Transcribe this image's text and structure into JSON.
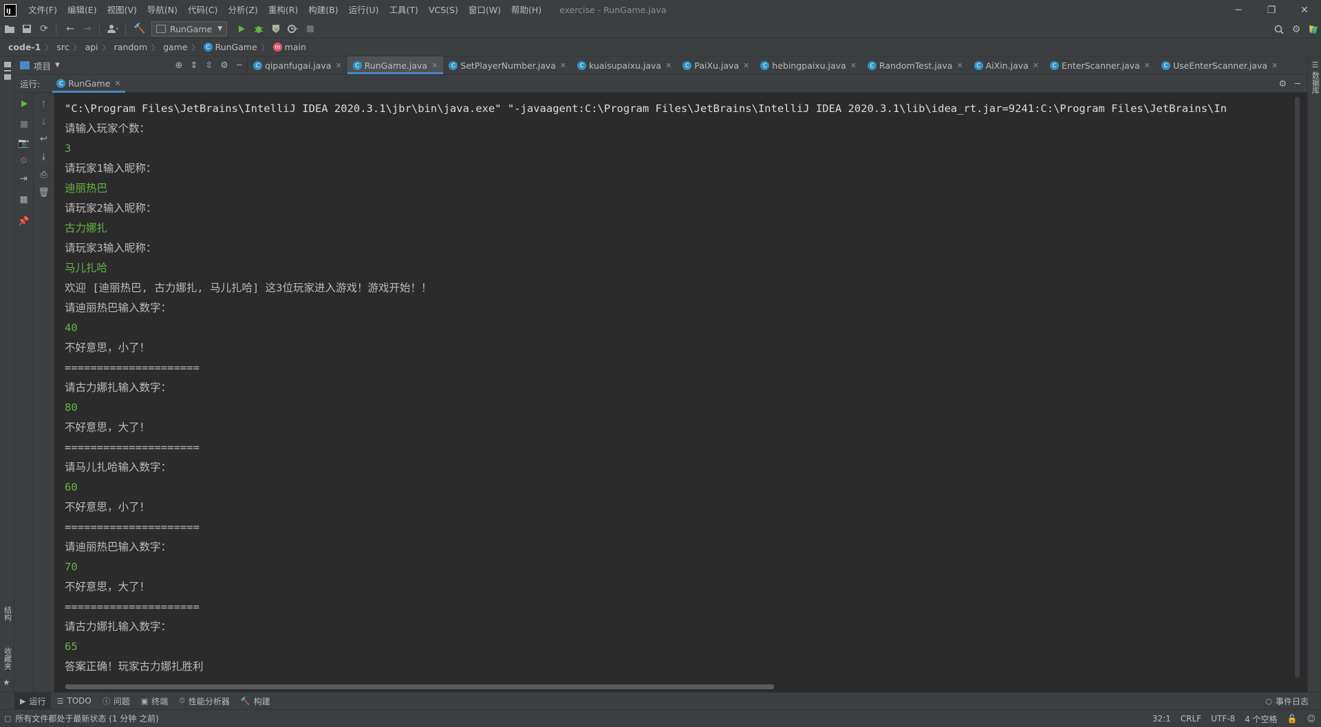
{
  "window": {
    "title": "exercise - RunGame.java",
    "minimize": "─",
    "restore": "❐",
    "close": "✕"
  },
  "menu": [
    "文件(F)",
    "编辑(E)",
    "视图(V)",
    "导航(N)",
    "代码(C)",
    "分析(Z)",
    "重构(R)",
    "构建(B)",
    "运行(U)",
    "工具(T)",
    "VCS(S)",
    "窗口(W)",
    "帮助(H)"
  ],
  "toolbar": {
    "run_config": "RunGame"
  },
  "breadcrumb": [
    "code-1",
    "src",
    "api",
    "random",
    "game",
    "RunGame",
    "main"
  ],
  "project_panel": {
    "label": "项目"
  },
  "editor_tabs": [
    {
      "label": "qipanfugai.java",
      "active": false
    },
    {
      "label": "RunGame.java",
      "active": true
    },
    {
      "label": "SetPlayerNumber.java",
      "active": false
    },
    {
      "label": "kuaisupaixu.java",
      "active": false
    },
    {
      "label": "PaiXu.java",
      "active": false
    },
    {
      "label": "hebingpaixu.java",
      "active": false
    },
    {
      "label": "RandomTest.java",
      "active": false
    },
    {
      "label": "AiXin.java",
      "active": false
    },
    {
      "label": "EnterScanner.java",
      "active": false
    },
    {
      "label": "UseEnterScanner.java",
      "active": false
    }
  ],
  "run_window": {
    "label": "运行:",
    "tab": "RunGame"
  },
  "console": {
    "lines": [
      {
        "text": "\"C:\\Program Files\\JetBrains\\IntelliJ IDEA 2020.3.1\\jbr\\bin\\java.exe\" \"-javaagent:C:\\Program Files\\JetBrains\\IntelliJ IDEA 2020.3.1\\lib\\idea_rt.jar=9241:C:\\Program Files\\JetBrains\\In",
        "kind": "cmd"
      },
      {
        "text": "请输入玩家个数：",
        "kind": "out"
      },
      {
        "text": "3",
        "kind": "input"
      },
      {
        "text": "请玩家1输入昵称：",
        "kind": "out"
      },
      {
        "text": "迪丽热巴",
        "kind": "input"
      },
      {
        "text": "请玩家2输入昵称：",
        "kind": "out"
      },
      {
        "text": "古力娜扎",
        "kind": "input"
      },
      {
        "text": "请玩家3输入昵称：",
        "kind": "out"
      },
      {
        "text": "马儿扎哈",
        "kind": "input"
      },
      {
        "text": "欢迎 [迪丽热巴, 古力娜扎, 马儿扎哈] 这3位玩家进入游戏！游戏开始！！",
        "kind": "out"
      },
      {
        "text": "请迪丽热巴输入数字：",
        "kind": "out"
      },
      {
        "text": "40",
        "kind": "input"
      },
      {
        "text": "不好意思，小了！",
        "kind": "out"
      },
      {
        "text": "=====================",
        "kind": "out"
      },
      {
        "text": "请古力娜扎输入数字：",
        "kind": "out"
      },
      {
        "text": "80",
        "kind": "input"
      },
      {
        "text": "不好意思，大了！",
        "kind": "out"
      },
      {
        "text": "=====================",
        "kind": "out"
      },
      {
        "text": "请马儿扎哈输入数字：",
        "kind": "out"
      },
      {
        "text": "60",
        "kind": "input"
      },
      {
        "text": "不好意思，小了！",
        "kind": "out"
      },
      {
        "text": "=====================",
        "kind": "out"
      },
      {
        "text": "请迪丽热巴输入数字：",
        "kind": "out"
      },
      {
        "text": "70",
        "kind": "input"
      },
      {
        "text": "不好意思，大了！",
        "kind": "out"
      },
      {
        "text": "=====================",
        "kind": "out"
      },
      {
        "text": "请古力娜扎输入数字：",
        "kind": "out"
      },
      {
        "text": "65",
        "kind": "input"
      },
      {
        "text": "答案正确！玩家古力娜扎胜利",
        "kind": "out"
      }
    ]
  },
  "left_strip": {
    "structure": "结构",
    "favorites": "收藏夹"
  },
  "right_strip": {
    "database": "数据库"
  },
  "bottom_tools": [
    {
      "label": "运行",
      "icon": "play-icon",
      "active": true
    },
    {
      "label": "TODO",
      "icon": "list-icon",
      "active": false
    },
    {
      "label": "问题",
      "icon": "info-icon",
      "active": false
    },
    {
      "label": "终端",
      "icon": "terminal-icon",
      "active": false
    },
    {
      "label": "性能分析器",
      "icon": "profiler-icon",
      "active": false
    },
    {
      "label": "构建",
      "icon": "hammer-icon",
      "active": false
    }
  ],
  "event_log": "事件日志",
  "status": {
    "message": "所有文件都处于最新状态 (1 分钟 之前)",
    "position": "32:1",
    "line_ending": "CRLF",
    "encoding": "UTF-8",
    "indent": "4 个空格"
  }
}
